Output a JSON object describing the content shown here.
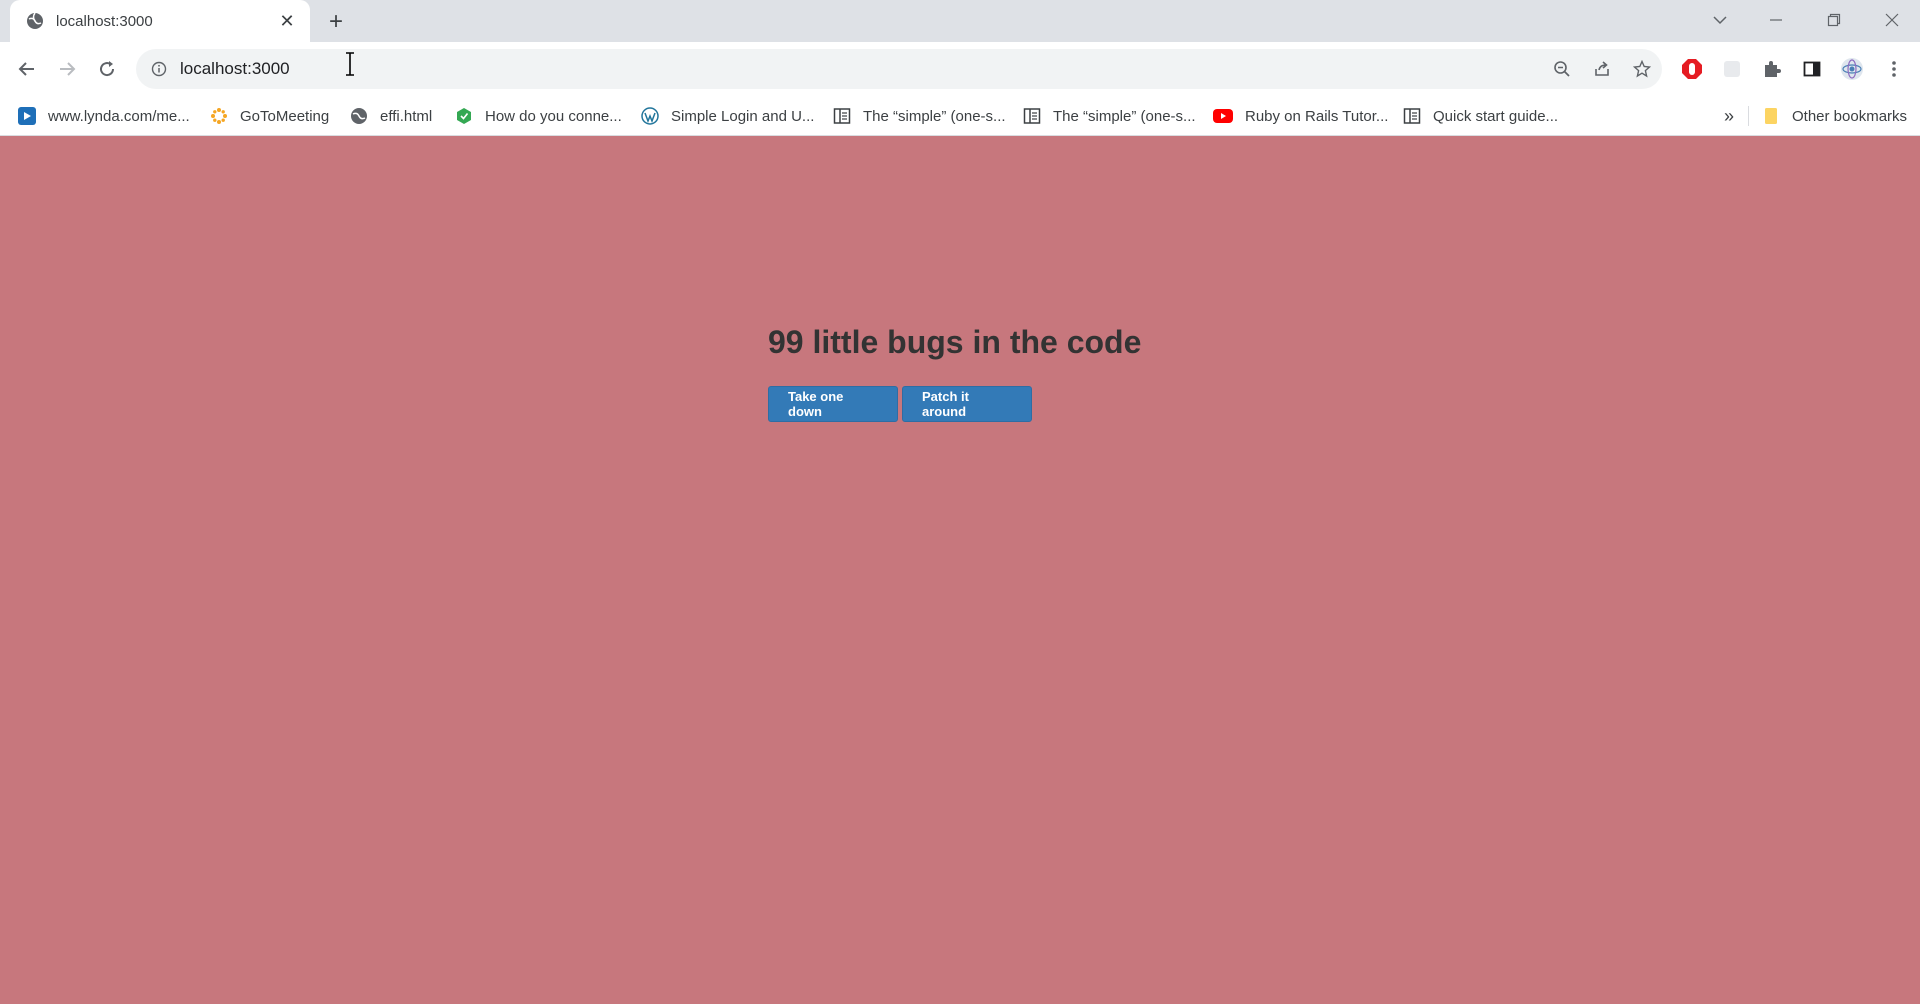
{
  "browser": {
    "tab": {
      "title": "localhost:3000"
    },
    "omnibox": {
      "url": "localhost:3000"
    },
    "bookmarks": [
      {
        "label": "www.lynda.com/me...",
        "icon": "lynda-icon",
        "color": "#1e6fb8"
      },
      {
        "label": "GoToMeeting",
        "icon": "gotomeeting-icon",
        "color": "#f5a623"
      },
      {
        "label": "effi.html",
        "icon": "globe-icon",
        "color": "#5f6368"
      },
      {
        "label": "How do you conne...",
        "icon": "hexagon-icon",
        "color": "#34a853"
      },
      {
        "label": "Simple Login and U...",
        "icon": "wordpress-icon",
        "color": "#21759b"
      },
      {
        "label": "The “simple” (one-s...",
        "icon": "document-icon",
        "color": "#3c4043"
      },
      {
        "label": "The “simple” (one-s...",
        "icon": "document-icon",
        "color": "#3c4043"
      },
      {
        "label": "Ruby on Rails Tutor...",
        "icon": "youtube-icon",
        "color": "#ff0000"
      },
      {
        "label": "Quick start guide...",
        "icon": "document-icon",
        "color": "#3c4043"
      }
    ],
    "overflow": "»",
    "other_bookmarks": "Other bookmarks"
  },
  "page": {
    "heading": "99 little bugs in the code",
    "button_take": "Take one down",
    "button_patch": "Patch it around",
    "background": "#c7777d",
    "button_color": "#337ab7"
  }
}
